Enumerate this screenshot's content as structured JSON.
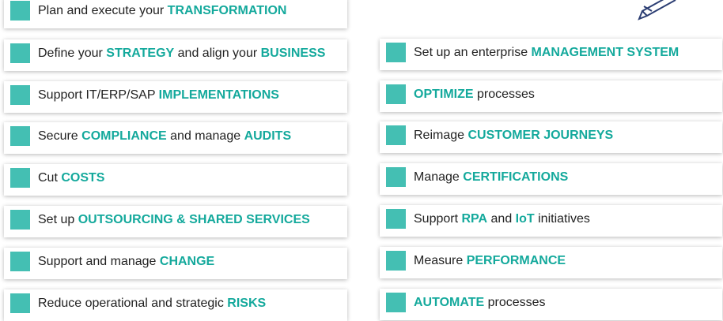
{
  "colors": {
    "accent": "#14a99c",
    "square": "#44bfb3",
    "text": "#222222"
  },
  "left_items": [
    {
      "segments": [
        {
          "t": "Plan and execute your ",
          "h": false
        },
        {
          "t": "TRANSFORMATION",
          "h": true
        }
      ]
    },
    {
      "segments": [
        {
          "t": "Define your ",
          "h": false
        },
        {
          "t": "STRATEGY",
          "h": true
        },
        {
          "t": " and align your ",
          "h": false
        },
        {
          "t": "BUSINESS",
          "h": true
        }
      ]
    },
    {
      "segments": [
        {
          "t": "Support IT/ERP/SAP ",
          "h": false
        },
        {
          "t": "IMPLEMENTATIONS",
          "h": true
        }
      ]
    },
    {
      "segments": [
        {
          "t": "Secure ",
          "h": false
        },
        {
          "t": "COMPLIANCE",
          "h": true
        },
        {
          "t": " and manage ",
          "h": false
        },
        {
          "t": "AUDITS",
          "h": true
        }
      ]
    },
    {
      "segments": [
        {
          "t": "Cut ",
          "h": false
        },
        {
          "t": "COSTS",
          "h": true
        }
      ]
    },
    {
      "segments": [
        {
          "t": "Set up ",
          "h": false
        },
        {
          "t": "OUTSOURCING & SHARED SERVICES",
          "h": true
        }
      ]
    },
    {
      "segments": [
        {
          "t": "Support and manage ",
          "h": false
        },
        {
          "t": "CHANGE",
          "h": true
        }
      ]
    },
    {
      "segments": [
        {
          "t": "Reduce operational and strategic ",
          "h": false
        },
        {
          "t": "RISKS",
          "h": true
        }
      ]
    }
  ],
  "right_items": [
    {
      "segments": [
        {
          "t": "Set up an enterprise ",
          "h": false
        },
        {
          "t": "MANAGEMENT SYSTEM",
          "h": true
        }
      ]
    },
    {
      "segments": [
        {
          "t": "OPTIMIZE",
          "h": true
        },
        {
          "t": " processes",
          "h": false
        }
      ]
    },
    {
      "segments": [
        {
          "t": "Reimage ",
          "h": false
        },
        {
          "t": "CUSTOMER JOURNEYS",
          "h": true
        }
      ]
    },
    {
      "segments": [
        {
          "t": "Manage ",
          "h": false
        },
        {
          "t": "CERTIFICATIONS",
          "h": true
        }
      ]
    },
    {
      "segments": [
        {
          "t": "Support ",
          "h": false
        },
        {
          "t": "RPA",
          "h": true
        },
        {
          "t": " and ",
          "h": false
        },
        {
          "t": "IoT",
          "h": true
        },
        {
          "t": " initiatives",
          "h": false
        }
      ]
    },
    {
      "segments": [
        {
          "t": "Measure ",
          "h": false
        },
        {
          "t": "PERFORMANCE",
          "h": true
        }
      ]
    },
    {
      "segments": [
        {
          "t": "AUTOMATE",
          "h": true
        },
        {
          "t": " processes",
          "h": false
        }
      ]
    }
  ],
  "decor": {
    "icon": "pencil-icon"
  }
}
